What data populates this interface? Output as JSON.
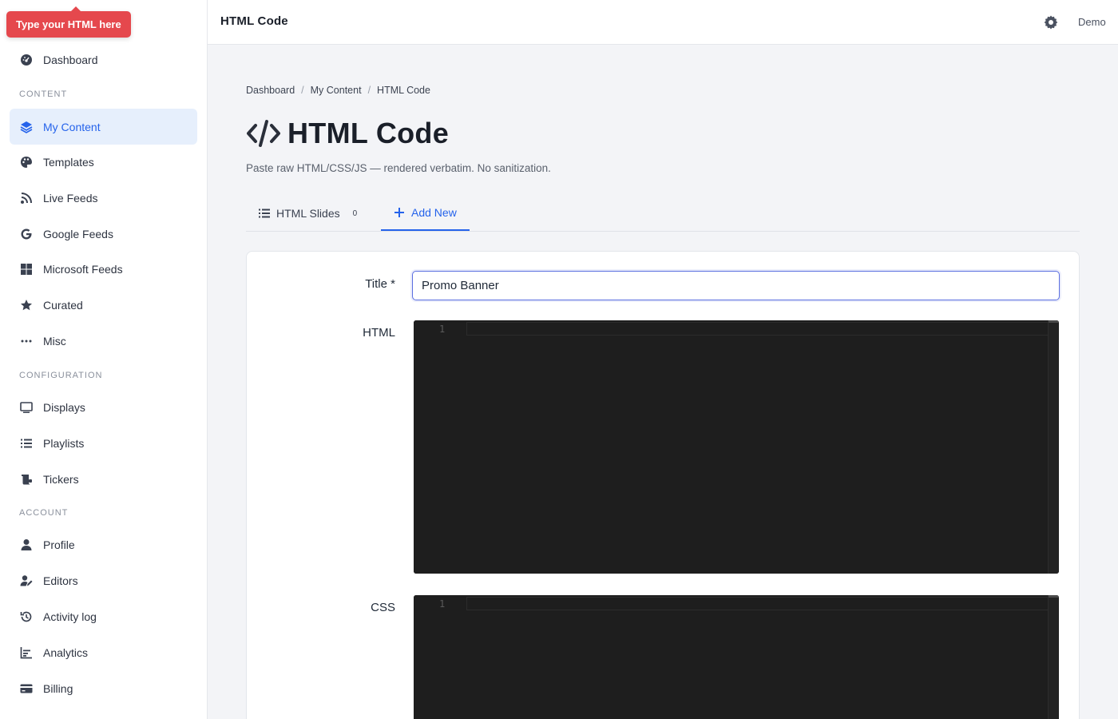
{
  "tooltip": "Type your HTML here",
  "sidebar": {
    "dashboard": "Dashboard",
    "sections": {
      "content": "CONTENT",
      "configuration": "CONFIGURATION",
      "account": "ACCOUNT"
    },
    "content_items": [
      {
        "label": "My Content",
        "icon": "layers-icon",
        "active": true
      },
      {
        "label": "Templates",
        "icon": "palette-icon"
      },
      {
        "label": "Live Feeds",
        "icon": "rss-icon"
      },
      {
        "label": "Google Feeds",
        "icon": "google-icon"
      },
      {
        "label": "Microsoft Feeds",
        "icon": "windows-icon"
      },
      {
        "label": "Curated",
        "icon": "star-icon"
      },
      {
        "label": "Misc",
        "icon": "ellipsis-icon"
      }
    ],
    "config_items": [
      {
        "label": "Displays",
        "icon": "monitor-icon"
      },
      {
        "label": "Playlists",
        "icon": "list-icon"
      },
      {
        "label": "Tickers",
        "icon": "scroll-icon"
      }
    ],
    "account_items": [
      {
        "label": "Profile",
        "icon": "user-icon"
      },
      {
        "label": "Editors",
        "icon": "user-edit-icon"
      },
      {
        "label": "Activity log",
        "icon": "history-icon"
      },
      {
        "label": "Analytics",
        "icon": "chart-icon"
      },
      {
        "label": "Billing",
        "icon": "credit-card-icon"
      }
    ]
  },
  "header": {
    "title": "HTML Code",
    "user": "Demo"
  },
  "breadcrumb": [
    "Dashboard",
    "My Content",
    "HTML Code"
  ],
  "page": {
    "title": "HTML Code",
    "subtitle": "Paste raw HTML/CSS/JS — rendered verbatim. No sanitization."
  },
  "tabs": [
    {
      "label": "HTML Slides",
      "count": "0",
      "active": false
    },
    {
      "label": "Add New",
      "active": true
    }
  ],
  "form": {
    "title_label": "Title *",
    "title_value": "Promo Banner",
    "html_label": "HTML",
    "css_label": "CSS",
    "line_number": "1"
  },
  "colors": {
    "accent": "#2563eb",
    "tooltip": "#e5484d",
    "editor_bg": "#1e1e1e"
  }
}
